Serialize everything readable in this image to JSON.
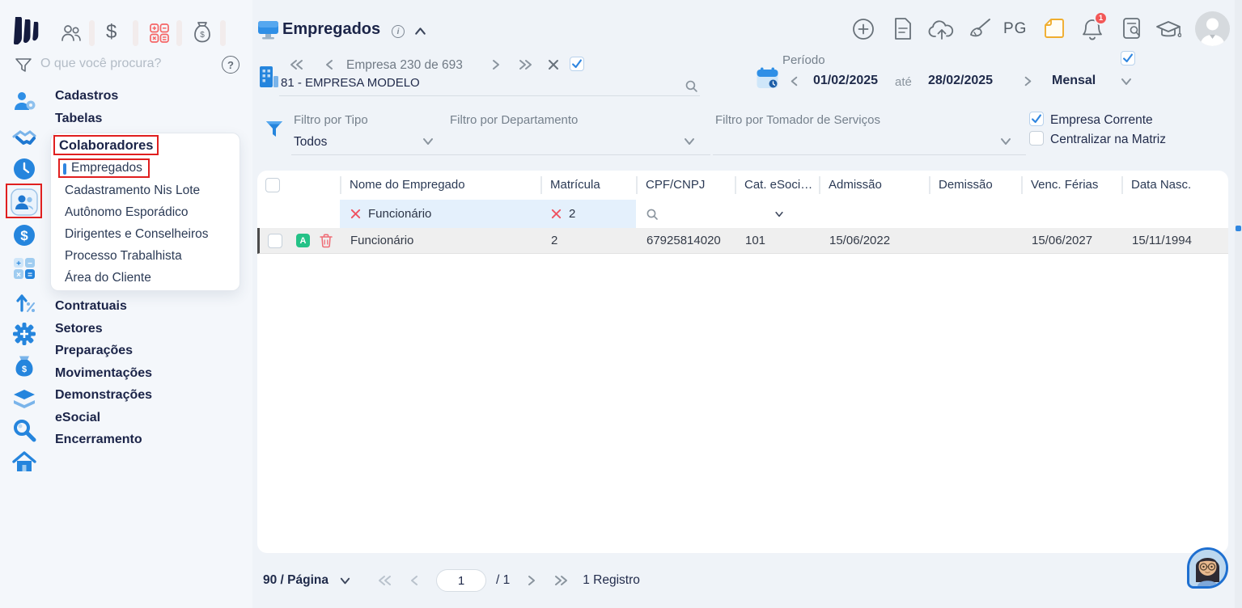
{
  "colors": {
    "accent_blue": "#2f86e0",
    "navy_text": "#1b2448",
    "annotation_red": "#e01f1f",
    "badge_green": "#24c287",
    "danger_red": "#ef6a74",
    "note_yellow": "#f0ad2e",
    "row_gray": "#efefef",
    "filter_cell_blue": "#e4f0fc"
  },
  "topbar": {
    "dollar_glyph": "$",
    "icon_names": [
      "people-icon",
      "dollar-icon",
      "calculator-icon",
      "money-bag-icon"
    ]
  },
  "sidebar": {
    "search_placeholder": "O que você procura?",
    "help_glyph": "?",
    "menu_top": [
      "Cadastros",
      "Tabelas"
    ],
    "popup": {
      "header": "Colaboradores",
      "items": [
        "Empregados",
        "Cadastramento Nis Lote",
        "Autônomo Esporádico",
        "Dirigentes e Conselheiros",
        "Processo Trabalhista",
        "Área do Cliente"
      ]
    },
    "menu_bottom": [
      "Contratuais",
      "Setores",
      "Preparações",
      "Movimentações",
      "Demonstrações",
      "eSocial",
      "Encerramento"
    ]
  },
  "header": {
    "title": "Empregados",
    "company_nav_label": "Empresa 230 de 693",
    "company_name": "81 - EMPRESA MODELO",
    "period_label": "Período",
    "period_start": "01/02/2025",
    "period_until": "até",
    "period_end": "28/02/2025",
    "period_mode": "Mensal",
    "pg_label": "PG",
    "bell_badge": "1"
  },
  "filters": {
    "tipo_label": "Filtro por Tipo",
    "tipo_value": "Todos",
    "departamento_label": "Filtro por Departamento",
    "tomador_label": "Filtro por Tomador de Serviços",
    "empresa_corrente_label": "Empresa Corrente",
    "centralizar_label": "Centralizar na Matriz"
  },
  "table": {
    "columns": [
      "Nome do Empregado",
      "Matrícula",
      "CPF/CNPJ",
      "Cat. eSoci…",
      "Admissão",
      "Demissão",
      "Venc. Férias",
      "Data Nasc."
    ],
    "filter_nome": "Funcionário",
    "filter_matricula": "2",
    "row": {
      "status_badge": "A",
      "nome": "Funcionário",
      "matricula": "2",
      "cpf": "67925814020",
      "cat": "101",
      "admissao": "15/06/2022",
      "demissao": "",
      "venc_ferias": "15/06/2027",
      "data_nasc": "15/11/1994"
    }
  },
  "pagination": {
    "per_page": "90 / Página",
    "page_value": "1",
    "page_total": "/ 1",
    "records": "1 Registro"
  }
}
